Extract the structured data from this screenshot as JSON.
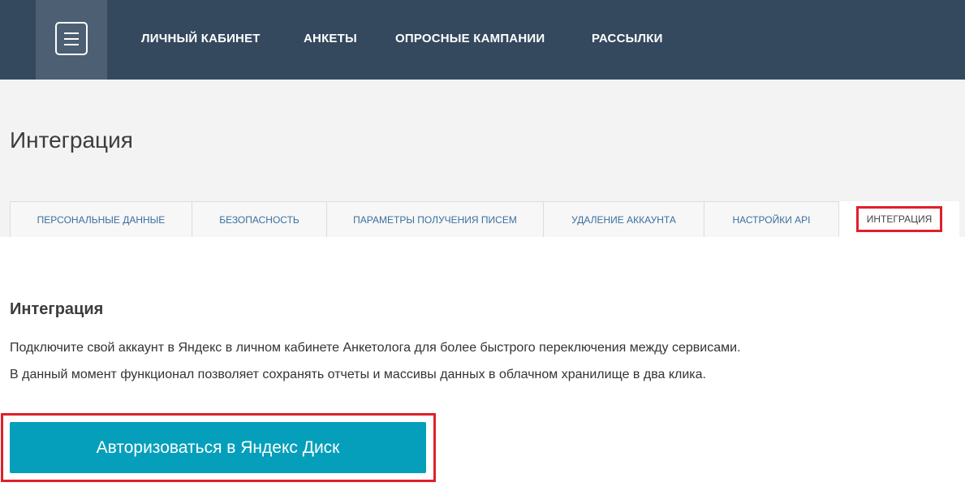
{
  "header": {
    "nav": [
      "ЛИЧНЫЙ КАБИНЕТ",
      "АНКЕТЫ",
      "ОПРОСНЫЕ КАМПАНИИ",
      "РАССЫЛКИ"
    ],
    "menu_icon": "hamburger-menu-icon"
  },
  "page": {
    "title": "Интеграция"
  },
  "tabs": [
    "ПЕРСОНАЛЬНЫЕ ДАННЫЕ",
    "БЕЗОПАСНОСТЬ",
    "ПАРАМЕТРЫ ПОЛУЧЕНИЯ ПИСЕМ",
    "УДАЛЕНИЕ АККАУНТА",
    "НАСТРОЙКИ API",
    "ИНТЕГРАЦИЯ"
  ],
  "active_tab": "ИНТЕГРАЦИЯ",
  "section": {
    "title": "Интеграция",
    "paragraphs": [
      "Подключите свой аккаунт в Яндекс в личном кабинете Анкетолога для более быстрого переключения между сервисами.",
      "В данный момент функционал позволяет сохранять отчеты и массивы данных в облачном хранилище в два клика."
    ],
    "button_label": "Авторизоваться в Яндекс Диск"
  },
  "colors": {
    "header_bg": "#34495e",
    "accent_button": "#059fbb",
    "highlight": "#e0202a",
    "tab_text": "#3a6f9f"
  }
}
